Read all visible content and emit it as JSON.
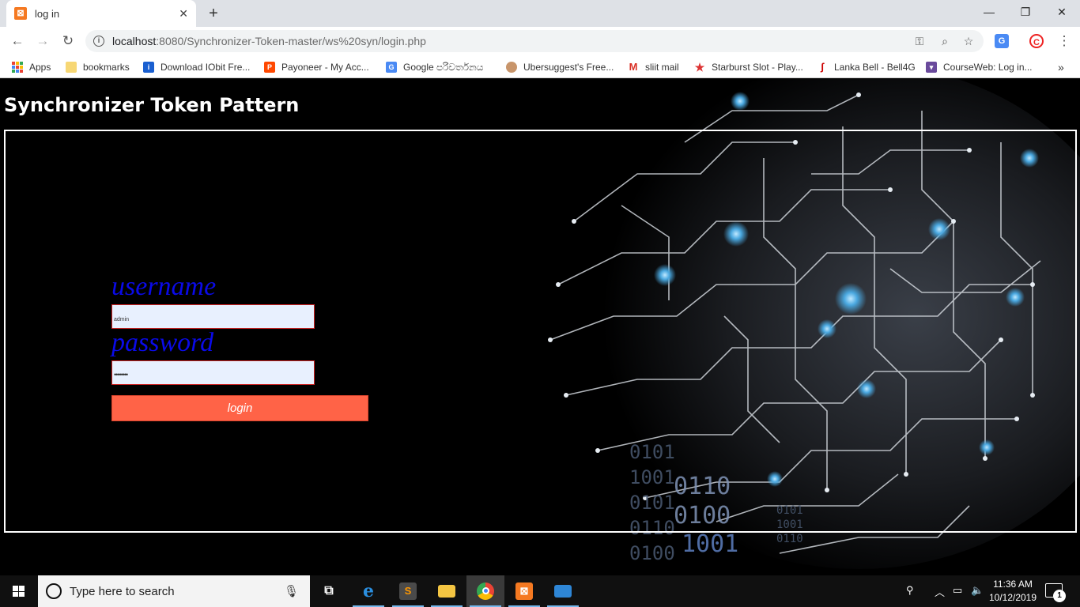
{
  "browser": {
    "tab_title": "log in",
    "tab_favicon": "xampp-icon",
    "url_host": "localhost",
    "url_rest": ":8080/Synchronizer-Token-master/ws%20syn/login.php"
  },
  "bookmarks": [
    {
      "label": "Apps",
      "icon": "apps-grid-icon"
    },
    {
      "label": "bookmarks",
      "icon": "folder-icon"
    },
    {
      "label": "Download IObit Fre...",
      "icon": "iobit-icon"
    },
    {
      "label": "Payoneer - My Acc...",
      "icon": "payoneer-icon"
    },
    {
      "label": "Google පරිවර්තනය",
      "icon": "google-translate-icon"
    },
    {
      "label": "Ubersuggest's Free...",
      "icon": "ubersuggest-icon"
    },
    {
      "label": "sliit mail",
      "icon": "gmail-icon"
    },
    {
      "label": "Starburst Slot - Play...",
      "icon": "star-icon"
    },
    {
      "label": "Lanka Bell - Bell4G",
      "icon": "lankabell-icon"
    },
    {
      "label": "CourseWeb: Log in...",
      "icon": "courseweb-icon"
    }
  ],
  "page": {
    "title": "Synchronizer Token Pattern",
    "username_label": "username",
    "username_value": "admin",
    "password_label": "password",
    "password_value": "••••••••",
    "login_label": "login",
    "button_color": "#ff6347",
    "label_color": "#0a0ae8"
  },
  "taskbar": {
    "search_placeholder": "Type here to search",
    "time": "11:36 AM",
    "date": "10/12/2019",
    "notification_count": "1",
    "apps": [
      "task-view-icon",
      "edge-icon",
      "sublime-icon",
      "file-explorer-icon",
      "chrome-icon",
      "xampp-icon",
      "remote-desktop-icon"
    ]
  }
}
